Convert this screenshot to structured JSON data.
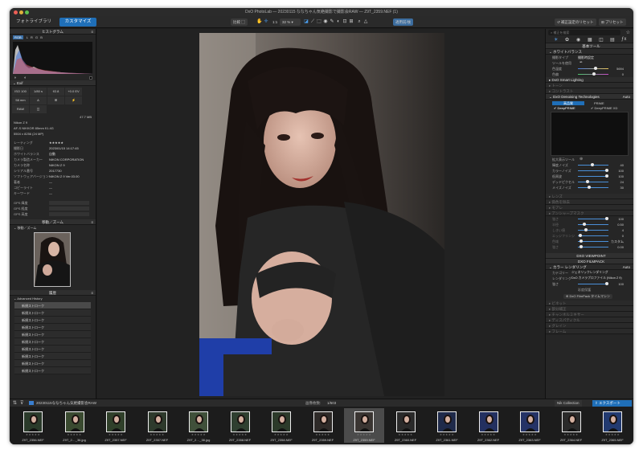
{
  "window": {
    "title": "DxO PhotoLab — 20230115 ななちゃん気絶撮影で撮影会RAW — Z9T_2359.NEF (1)",
    "tabs": [
      {
        "label": "フォトライブラリ"
      },
      {
        "label": "カスタマイズ"
      }
    ],
    "compare_label": "比較",
    "zoom": "1:1",
    "zoom_percent": "32 %",
    "before_after": "適用前/後",
    "reset_label": "補正設定のリセット",
    "preset_label": "プリセット"
  },
  "left_panel": {
    "histogram": {
      "title": "ヒストグラム",
      "channels": [
        "RGB",
        "L",
        "R",
        "G",
        "B"
      ]
    },
    "exif": {
      "title": "Exif",
      "cells": [
        "ISO 100",
        "1/80 s",
        "f/2.8",
        "+0.0 EV",
        "58 mm",
        "A",
        "",
        "",
        "RAW",
        ""
      ],
      "size": "47.7 MB",
      "camera": "Nikon Z 9",
      "lens": "AF-S NIKKOR 85mm f/1.4G",
      "dims": "5504 x 8256 (24 MP)"
    },
    "metadata": [
      {
        "label": "レーティング",
        "value": "★★★★★"
      },
      {
        "label": "撮影日",
        "value": "2023/01/15 14:17:45"
      },
      {
        "label": "ホワイトバランス",
        "value": "自動"
      },
      {
        "label": "カメラ製造メーカー",
        "value": "NIKON CORPORATION"
      },
      {
        "label": "カメラ名称",
        "value": "NIKON Z 9"
      },
      {
        "label": "シリアル番号",
        "value": "2017730"
      },
      {
        "label": "ソフトウェアバージョン",
        "value": "NIKON Z 9 Ver.03.00"
      },
      {
        "label": "著者",
        "value": "—"
      },
      {
        "label": "コピーライト",
        "value": "—"
      },
      {
        "label": "キーワード",
        "value": "—"
      }
    ],
    "gps": [
      {
        "label": "GPS 緯度"
      },
      {
        "label": "GPS 経度"
      },
      {
        "label": "GPS 高度"
      }
    ],
    "nav_title": "移動／ズーム",
    "nav_sub": "移動／ズーム",
    "history_title": "履歴",
    "history_sub": "Advanced History",
    "history_items": [
      "新規ストローク",
      "新規ストローク",
      "新規ストローク",
      "新規ストローク",
      "新規ストローク",
      "新規ストローク",
      "新規ストローク",
      "新規ストローク",
      "新規ストローク",
      "新規ストローク"
    ]
  },
  "right_panel": {
    "search_placeholder": "補正を検索",
    "basic_tools": "基本ツール",
    "white_balance": "ホワイトバランス",
    "wb_type": {
      "label": "撮影タイプ",
      "value": "撮影時設定"
    },
    "wb_picker": "ツールを使用",
    "wb_sliders": [
      {
        "label": "色温度",
        "value": "5694"
      },
      {
        "label": "色偏",
        "value": "0"
      }
    ],
    "smart_lighting": "DxO Smart Lighting",
    "auto_tone": "トーン",
    "contrast": "コントラスト",
    "denoising": {
      "title": "DxO Denoising Technologies",
      "mode_label": "Auto"
    },
    "denoise_modes": [
      "高品質",
      "PRIME",
      "DeepPRIME",
      "DeepPRIME XD"
    ],
    "preview_label": "拡大表示ツール",
    "noise_sliders": [
      {
        "label": "輝度ノイズ",
        "value": "40"
      },
      {
        "label": "カラーノイズ",
        "value": "100"
      },
      {
        "label": "低周波",
        "value": "100"
      },
      {
        "label": "デッドピクセル",
        "value": "24"
      },
      {
        "label": "メイズノイズ",
        "value": "30"
      }
    ],
    "dim_items": [
      "レンズ",
      "偽色を除去",
      "モアレ",
      "アンシャープマスク"
    ],
    "sharpen": [
      {
        "label": "強さ",
        "value": "100"
      },
      {
        "label": "半径",
        "value": "0.50"
      },
      {
        "label": "しきい値",
        "value": "4"
      },
      {
        "label": "エッジフリンジ",
        "value": "0"
      }
    ],
    "fringe": [
      {
        "label": "色域",
        "value": "カスタム"
      },
      {
        "label": "強さ",
        "value": "0.00"
      }
    ],
    "viewpoint": "DXO VIEWPOINT",
    "filmpack": "DXO FILMPACK",
    "color_rendering": {
      "title": "カラー レンダリング",
      "mode": "Auto"
    },
    "rendering_rows": [
      {
        "label": "カテゴリー",
        "value": "ジェネリックレンダリング"
      },
      {
        "label": "レンダリング",
        "value": "DxO カメラプロファイル (Nikon Z 9)"
      }
    ],
    "intensity": {
      "label": "強さ",
      "value": "100"
    },
    "protect": "彩度保護",
    "filmpack_link": "DxO FilmPack タイムマシン",
    "bottom_dim": [
      "ビネット",
      "部分補正",
      "チャンネルミキサー",
      "ディスパティクル",
      "グレイン",
      "フレーム"
    ]
  },
  "filmstrip": {
    "folder": "20230115ななちゃん気絶撮影会RAW",
    "count": "画像枚数:",
    "count_value": "1/503",
    "nik_label": "Nik Collection",
    "export_label": "エクスポート",
    "items": [
      {
        "name": "Z9T_2356.NEF",
        "bg": "#2a3a2a"
      },
      {
        "name": "Z9T_2…_36.jpg",
        "bg": "#3a4a30"
      },
      {
        "name": "Z9T_2357.NEF",
        "bg": "#30402a"
      },
      {
        "name": "Z9T_2357.NEF",
        "bg": "#2e3a2c"
      },
      {
        "name": "Z9T_2…_38.jpg",
        "bg": "#40503a"
      },
      {
        "name": "Z9T_2358.NEF",
        "bg": "#2f3f30"
      },
      {
        "name": "Z9T_2358.NEF",
        "bg": "#2c3a2a"
      },
      {
        "name": "Z9T_2359.NEF",
        "bg": "#2e2a28"
      },
      {
        "name": "Z9T_2359.NEF",
        "bg": "#3a3532"
      },
      {
        "name": "Z9T_2360.NEF",
        "bg": "#2a2a2a"
      },
      {
        "name": "Z9T_2361.NEF",
        "bg": "#1f2a4a"
      },
      {
        "name": "Z9T_2362.NEF",
        "bg": "#233060"
      },
      {
        "name": "Z9T_2363.NEF",
        "bg": "#253366"
      },
      {
        "name": "Z9T_2364.NEF",
        "bg": "#2a2a2a"
      },
      {
        "name": "Z9T_2365.NEF",
        "bg": "#223a70"
      }
    ]
  },
  "colors": {
    "accent": "#1f6fb8",
    "panel": "#262626"
  }
}
